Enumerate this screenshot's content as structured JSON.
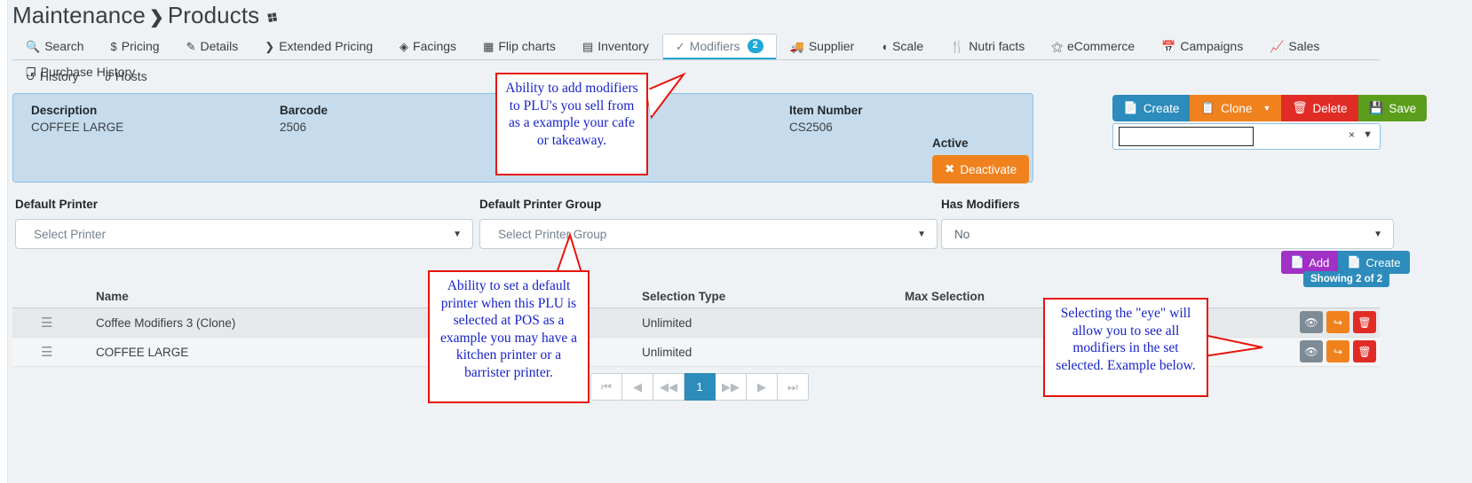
{
  "breadcrumb": {
    "root": "Maintenance",
    "separator": "❯",
    "current": "Products",
    "pin": "📌"
  },
  "tabs_row1": [
    {
      "label": "Search",
      "icon": "search-icon",
      "glyph": "🔍",
      "active": false
    },
    {
      "label": "Pricing",
      "icon": "dollar-icon",
      "glyph": "$",
      "active": false
    },
    {
      "label": "Details",
      "icon": "edit-icon",
      "glyph": "✎",
      "active": false
    },
    {
      "label": "Extended Pricing",
      "icon": "chevron-right-icon",
      "glyph": "❯",
      "active": false
    },
    {
      "label": "Facings",
      "icon": "tag-icon",
      "glyph": "🏷",
      "active": false
    },
    {
      "label": "Flip charts",
      "icon": "grid-icon",
      "glyph": "▒",
      "active": false
    },
    {
      "label": "Inventory",
      "icon": "archive-icon",
      "glyph": "☰",
      "active": false
    },
    {
      "label": "Modifiers",
      "icon": "check-circle-icon",
      "glyph": "✔",
      "active": true,
      "badge": "2"
    },
    {
      "label": "Supplier",
      "icon": "truck-icon",
      "glyph": "🚚",
      "active": false
    },
    {
      "label": "Scale",
      "icon": "gauge-icon",
      "glyph": "◔",
      "active": false
    },
    {
      "label": "Nutri facts",
      "icon": "cutlery-icon",
      "glyph": "🍴",
      "active": false
    },
    {
      "label": "eCommerce",
      "icon": "globe-icon",
      "glyph": "⊕",
      "active": false
    },
    {
      "label": "Campaigns",
      "icon": "calendar-icon",
      "glyph": "📅",
      "active": false
    },
    {
      "label": "Sales",
      "icon": "chart-line-icon",
      "glyph": "📈",
      "active": false
    },
    {
      "label": "Purchase History",
      "icon": "copy-stack-icon",
      "glyph": "❐",
      "active": false
    }
  ],
  "tabs_row2": [
    {
      "label": "History",
      "icon": "history-icon",
      "glyph": "↺",
      "active": false
    },
    {
      "label": "Hosts",
      "icon": "share-icon",
      "glyph": "⑂",
      "active": false
    }
  ],
  "info_panel": {
    "description_label": "Description",
    "description_value": "COFFEE LARGE",
    "barcode_label": "Barcode",
    "barcode_value": "2506",
    "item_number_label": "Item Number",
    "item_number_value": "CS2506",
    "active_label": "Active",
    "deactivate_label": "Deactivate"
  },
  "top_actions": {
    "create": "Create",
    "clone": "Clone",
    "delete": "Delete",
    "save": "Save",
    "select_value": "",
    "clear_glyph": "×"
  },
  "form": {
    "default_printer_label": "Default Printer",
    "default_printer_value": "Select Printer",
    "default_printer_group_label": "Default Printer Group",
    "default_printer_group_value": "Select Printer Group",
    "has_modifiers_label": "Has Modifiers",
    "has_modifiers_value": "No"
  },
  "list_actions": {
    "add": "Add",
    "create": "Create",
    "showing": "Showing 2 of 2"
  },
  "table": {
    "columns": [
      "",
      "Name",
      "Selection Type",
      "Max Selection"
    ],
    "rows": [
      {
        "handle": "☰",
        "name": "Coffee Modifiers 3 (Clone)",
        "selection_type": "Unlimited",
        "max_selection": ""
      },
      {
        "handle": "☰",
        "name": "COFFEE LARGE",
        "selection_type": "Unlimited",
        "max_selection": ""
      }
    ],
    "row_actions": [
      {
        "name": "view-eye-button",
        "glyph": "👁"
      },
      {
        "name": "share-arrow-button",
        "glyph": "↪"
      },
      {
        "name": "delete-trash-button",
        "glyph": "🗑"
      }
    ]
  },
  "pagination": {
    "first": "⏮",
    "prev_page": "◀",
    "prev": "◀◀",
    "current": "1",
    "next": "▶▶",
    "next_page": "▶",
    "last": "⏭"
  },
  "annotations": {
    "a1": "Ability to add modifiers to PLU's you sell from as a example your cafe or takeaway.",
    "a2": "Ability to set a default printer when this PLU is selected at POS as a example you may have a kitchen printer or a barrister printer.",
    "a3": "Selecting the \"eye\" will allow you to see all modifiers in the set selected.  Example below."
  },
  "colors": {
    "accent": "#20a8d8",
    "create": "#2d8cbb",
    "clone": "#f0821e",
    "delete": "#e12c26",
    "save": "#5a9e1b",
    "add": "#a031c4",
    "panel": "#c6dced",
    "annotation_border": "#e8130b",
    "annotation_text": "#1623c8"
  }
}
